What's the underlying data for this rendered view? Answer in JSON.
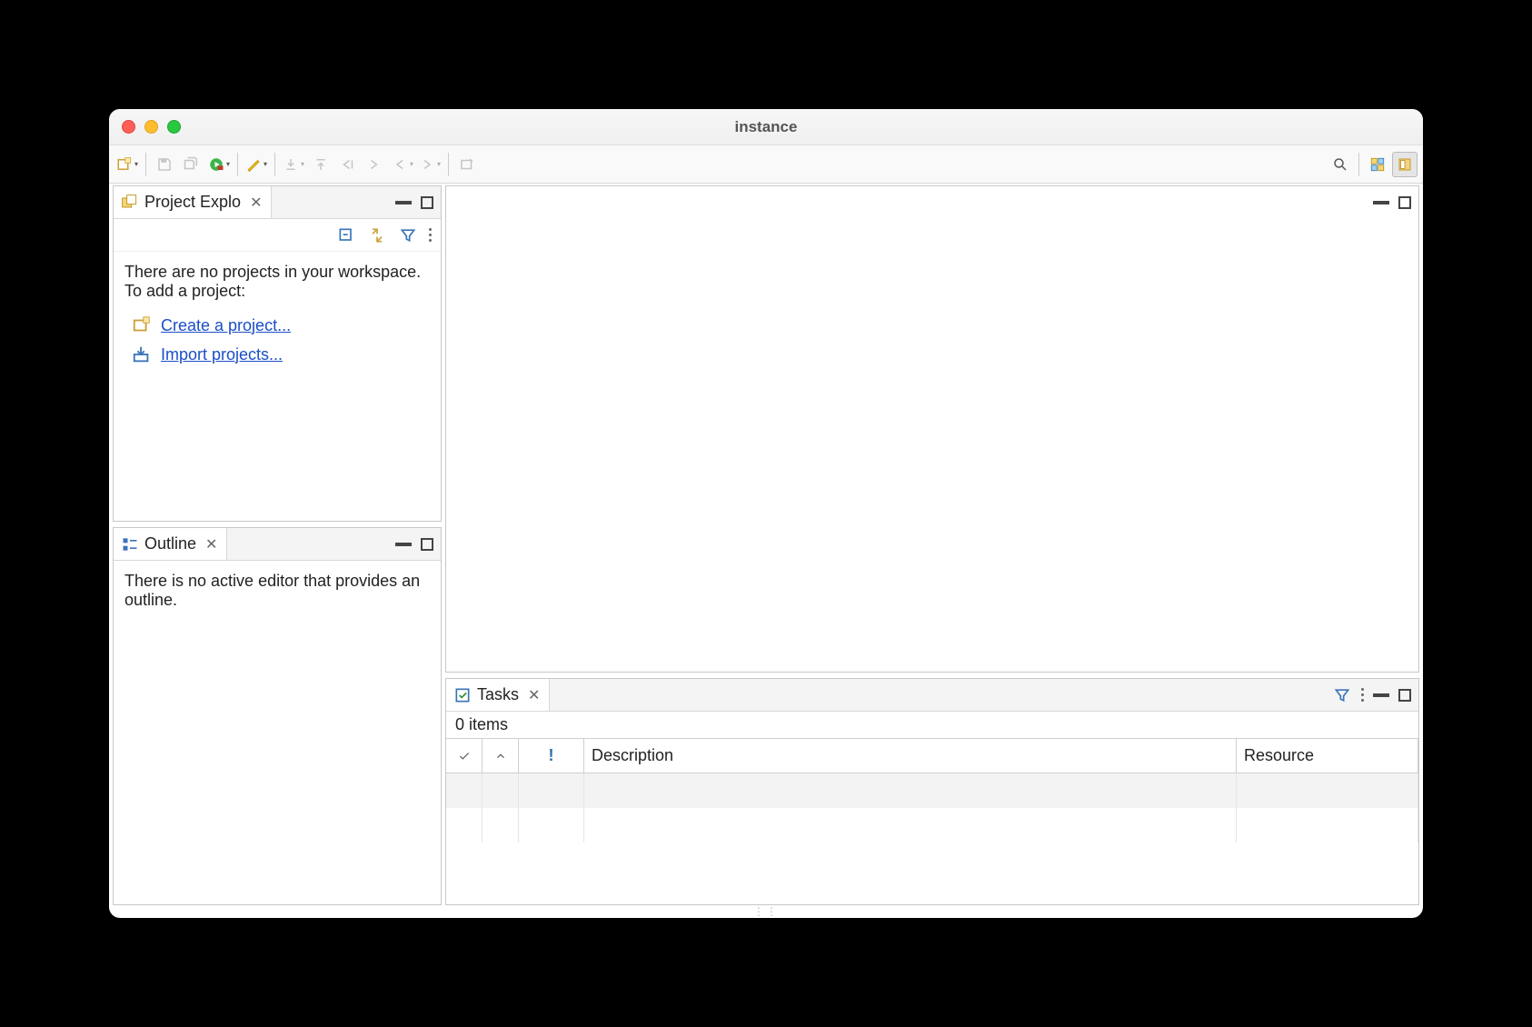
{
  "window": {
    "title": "instance"
  },
  "left": {
    "explorer": {
      "tab_label": "Project Explo",
      "empty_line1": "There are no projects in your workspace.",
      "empty_line2": "To add a project:",
      "create_link": "Create a project...",
      "import_link": "Import projects..."
    },
    "outline": {
      "tab_label": "Outline",
      "empty": "There is no active editor that provides an outline."
    }
  },
  "tasks": {
    "tab_label": "Tasks",
    "count_text": "0 items",
    "columns": {
      "description": "Description",
      "resource": "Resource"
    }
  }
}
